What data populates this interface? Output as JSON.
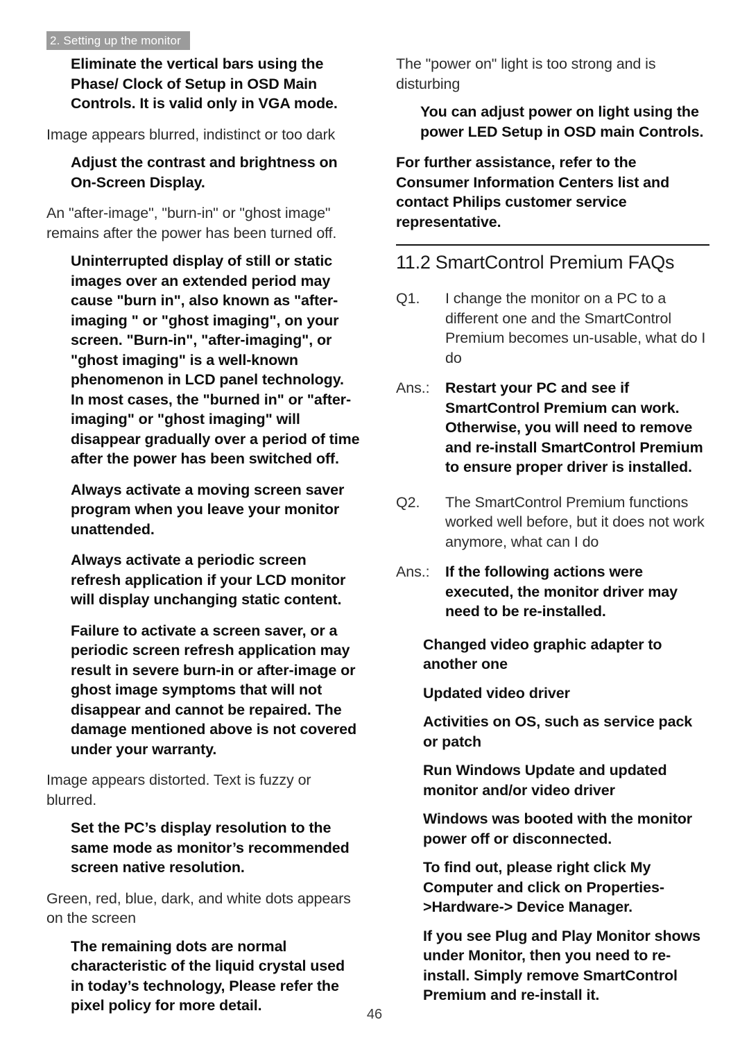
{
  "header": {
    "chapter_tab": "2. Setting up the monitor"
  },
  "footer": {
    "page_number": "46"
  },
  "colors": {
    "header_tab_background": "#9b9b9b",
    "header_tab_text": "#ffffff",
    "body_text": "#1a1a1a",
    "rule": "#121212"
  },
  "left_column": {
    "blocks": [
      {
        "style": "solution",
        "text": "Eliminate the vertical bars using the Phase/ Clock of Setup in OSD Main Controls. It is valid only in VGA mode."
      },
      {
        "style": "light",
        "text": "Image appears blurred, indistinct or too dark"
      },
      {
        "style": "solution",
        "text": "Adjust the contrast and brightness on On-Screen Display."
      },
      {
        "style": "light",
        "text": "An \"after-image\", \"burn-in\" or \"ghost image\" remains after the power has been turned off."
      },
      {
        "style": "solution",
        "text": "Uninterrupted display of still or static images over an extended period may cause \"burn in\", also known as \"after-imaging \" or \"ghost imaging\", on your screen. \"Burn-in\", \"after-imaging\", or \"ghost imaging\" is a well-known phenomenon in LCD panel technology. In most cases, the \"burned in\" or \"after-imaging\" or \"ghost imaging\" will disappear gradually over a period of time after the power has been switched off."
      },
      {
        "style": "solution",
        "text": "Always activate a moving screen saver program when you leave your monitor unattended."
      },
      {
        "style": "solution",
        "text": "Always activate a periodic screen refresh application if your LCD monitor will display unchanging static content."
      },
      {
        "style": "solution",
        "text": "Failure to activate a screen saver, or a periodic screen refresh application may result in severe burn-in or after-image or ghost image symptoms that will not disappear and cannot be repaired. The damage mentioned above is not covered under your warranty."
      },
      {
        "style": "light",
        "text": "Image appears distorted. Text is fuzzy or blurred."
      },
      {
        "style": "solution",
        "text": "Set the PC’s display resolution to the same mode as monitor’s recommended screen native resolution."
      },
      {
        "style": "light",
        "text": "Green, red, blue, dark, and white dots appears on the screen"
      },
      {
        "style": "solution",
        "text": "The remaining dots are normal characteristic of the liquid crystal used in today’s technology, Please refer the pixel policy for more detail."
      }
    ]
  },
  "right_column": {
    "top_blocks": [
      {
        "style": "light",
        "text": "The \"power on\" light is too strong and is disturbing"
      },
      {
        "style": "solution",
        "text": "You can adjust power on light using the power LED Setup in OSD main Controls."
      },
      {
        "style": "boldflush",
        "text": "For further assistance, refer to the Consumer Information Centers list and contact Philips customer service representative."
      }
    ],
    "section": {
      "number": "11.2",
      "title": "SmartControl Premium FAQs"
    },
    "faqs": [
      {
        "question_label": "Q1.",
        "question_text": "I change the monitor on a PC to a different one and the SmartControl Premium becomes un-usable, what do I do",
        "answer_label": "Ans.:",
        "answer_text": "Restart your PC and see if SmartControl Premium can work. Otherwise, you will need to remove and re-install SmartControl Premium to ensure proper driver is installed."
      },
      {
        "question_label": "Q2.",
        "question_text": "The SmartControl Premium functions worked well before, but it does not work anymore, what can I do",
        "answer_label": "Ans.:",
        "answer_text": "If the following actions were executed, the monitor driver may need to be re-installed."
      }
    ],
    "action_list": [
      "Changed video graphic adapter to another one",
      "Updated video driver",
      "Activities on OS, such as service pack or patch",
      "Run Windows Update and updated monitor and/or video driver",
      "Windows was booted with the monitor power off or disconnected."
    ],
    "closing_blocks": [
      "To find out, please right click My Computer and click on Properties->Hardware-> Device Manager.",
      "If you see Plug and Play Monitor shows under Monitor, then you need to re-install. Simply remove SmartControl Premium and re-install it."
    ]
  }
}
